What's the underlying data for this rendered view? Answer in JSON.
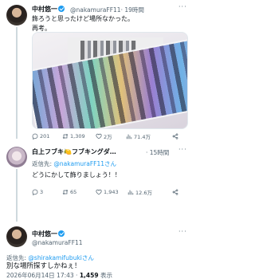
{
  "tweet1": {
    "name": "中村悠一",
    "handle": "@nakamuraFF11",
    "time": "· 19時間",
    "text": "飾ろうと思ったけど場所なかった。\n再考。",
    "metrics": {
      "replies": "201",
      "retweets": "1,309",
      "likes": "2万",
      "views": "71.4万"
    }
  },
  "tweet2": {
    "name": "白上フブキ🍋フブキングダ…",
    "handle": "",
    "time": "· 15時間",
    "reply_prefix": "返信先: ",
    "reply_mention": "@nakamuraFF11さん",
    "text": "どうにかして飾りましょう！！",
    "metrics": {
      "replies": "3",
      "retweets": "65",
      "likes": "1,943",
      "views": "12.6万"
    }
  },
  "tweet3": {
    "name": "中村悠一",
    "handle": "@nakamuraFF11",
    "reply_prefix": "返信先: ",
    "reply_mention": "@shirakamifubukiさん",
    "text": "別な場所探すしかねぇ！",
    "timestamp": "2026年06月14日 17:43 · ",
    "views_count": "1,459",
    "views_label": " 表示"
  },
  "icons": [
    "reply-icon",
    "retweet-icon",
    "like-icon",
    "views-icon",
    "share-icon",
    "more-icon",
    "verified-badge-icon"
  ],
  "colors": {
    "accent": "#1d9bf0",
    "muted": "#536471",
    "text": "#0f1419",
    "divider": "#eff3f4"
  }
}
